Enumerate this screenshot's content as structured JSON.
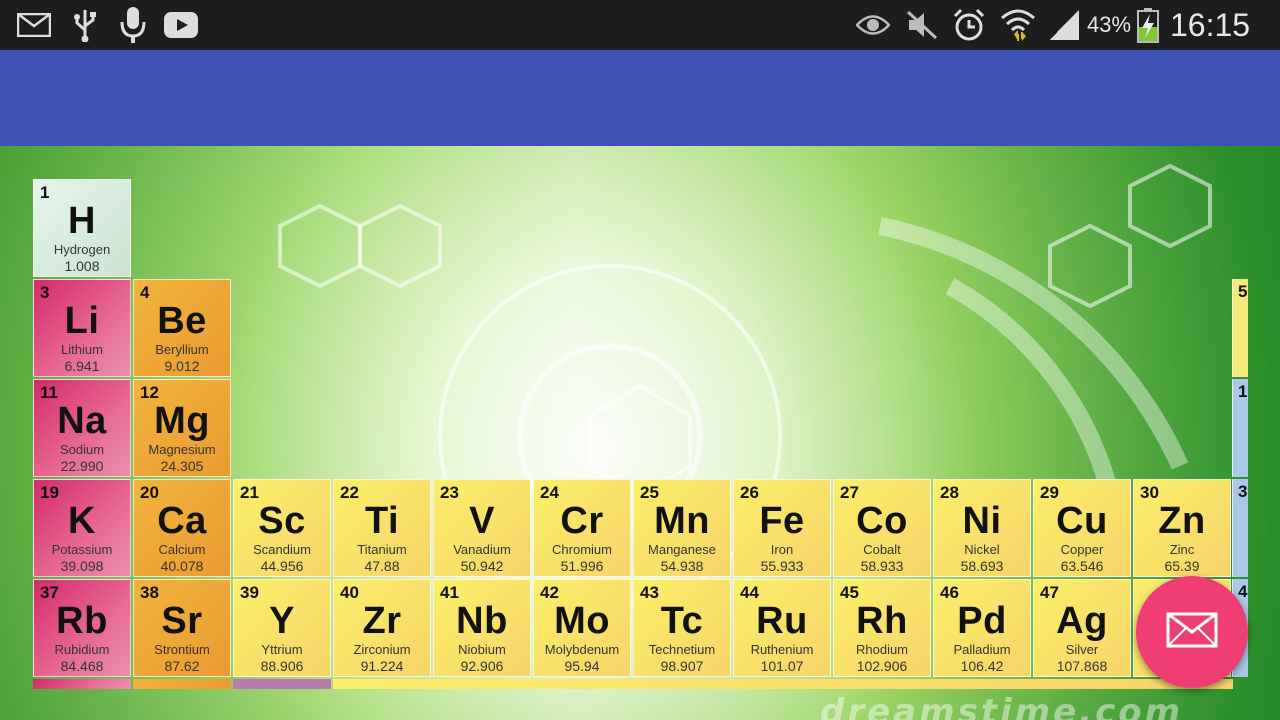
{
  "status_bar": {
    "left_icons": [
      "mail-icon",
      "usb-icon",
      "microphone-icon",
      "youtube-icon"
    ],
    "right_icons": [
      "eye-icon",
      "mute-icon",
      "alarm-icon",
      "wifi-icon",
      "signal-icon",
      "battery-charging-icon"
    ],
    "battery": "43%",
    "time": "16:15"
  },
  "colors": {
    "app_bar": "#3f51b5",
    "fab": "#ef3e73",
    "alkali": "#d42a6a",
    "alkaline_earth": "#f2b43c",
    "transition": "#fbef6a"
  },
  "watermark": "dreamstime.com",
  "fab": {
    "icon": "mail-icon"
  },
  "elements": [
    {
      "num": "1",
      "sym": "H",
      "name": "Hydrogen",
      "mass": "1.008"
    },
    {
      "num": "3",
      "sym": "Li",
      "name": "Lithium",
      "mass": "6.941"
    },
    {
      "num": "4",
      "sym": "Be",
      "name": "Beryllium",
      "mass": "9.012"
    },
    {
      "num": "11",
      "sym": "Na",
      "name": "Sodium",
      "mass": "22.990"
    },
    {
      "num": "12",
      "sym": "Mg",
      "name": "Magnesium",
      "mass": "24.305"
    },
    {
      "num": "19",
      "sym": "K",
      "name": "Potassium",
      "mass": "39.098"
    },
    {
      "num": "20",
      "sym": "Ca",
      "name": "Calcium",
      "mass": "40.078"
    },
    {
      "num": "21",
      "sym": "Sc",
      "name": "Scandium",
      "mass": "44.956"
    },
    {
      "num": "22",
      "sym": "Ti",
      "name": "Titanium",
      "mass": "47.88"
    },
    {
      "num": "23",
      "sym": "V",
      "name": "Vanadium",
      "mass": "50.942"
    },
    {
      "num": "24",
      "sym": "Cr",
      "name": "Chromium",
      "mass": "51.996"
    },
    {
      "num": "25",
      "sym": "Mn",
      "name": "Manganese",
      "mass": "54.938"
    },
    {
      "num": "26",
      "sym": "Fe",
      "name": "Iron",
      "mass": "55.933"
    },
    {
      "num": "27",
      "sym": "Co",
      "name": "Cobalt",
      "mass": "58.933"
    },
    {
      "num": "28",
      "sym": "Ni",
      "name": "Nickel",
      "mass": "58.693"
    },
    {
      "num": "29",
      "sym": "Cu",
      "name": "Copper",
      "mass": "63.546"
    },
    {
      "num": "30",
      "sym": "Zn",
      "name": "Zinc",
      "mass": "65.39"
    },
    {
      "num": "37",
      "sym": "Rb",
      "name": "Rubidium",
      "mass": "84.468"
    },
    {
      "num": "38",
      "sym": "Sr",
      "name": "Strontium",
      "mass": "87.62"
    },
    {
      "num": "39",
      "sym": "Y",
      "name": "Yttrium",
      "mass": "88.906"
    },
    {
      "num": "40",
      "sym": "Zr",
      "name": "Zirconium",
      "mass": "91.224"
    },
    {
      "num": "41",
      "sym": "Nb",
      "name": "Niobium",
      "mass": "92.906"
    },
    {
      "num": "42",
      "sym": "Mo",
      "name": "Molybdenum",
      "mass": "95.94"
    },
    {
      "num": "43",
      "sym": "Tc",
      "name": "Technetium",
      "mass": "98.907"
    },
    {
      "num": "44",
      "sym": "Ru",
      "name": "Ruthenium",
      "mass": "101.07"
    },
    {
      "num": "45",
      "sym": "Rh",
      "name": "Rhodium",
      "mass": "102.906"
    },
    {
      "num": "46",
      "sym": "Pd",
      "name": "Palladium",
      "mass": "106.42"
    },
    {
      "num": "47",
      "sym": "Ag",
      "name": "Silver",
      "mass": "107.868"
    }
  ],
  "partial_numbers": [
    "5",
    "1",
    "3",
    "4"
  ]
}
